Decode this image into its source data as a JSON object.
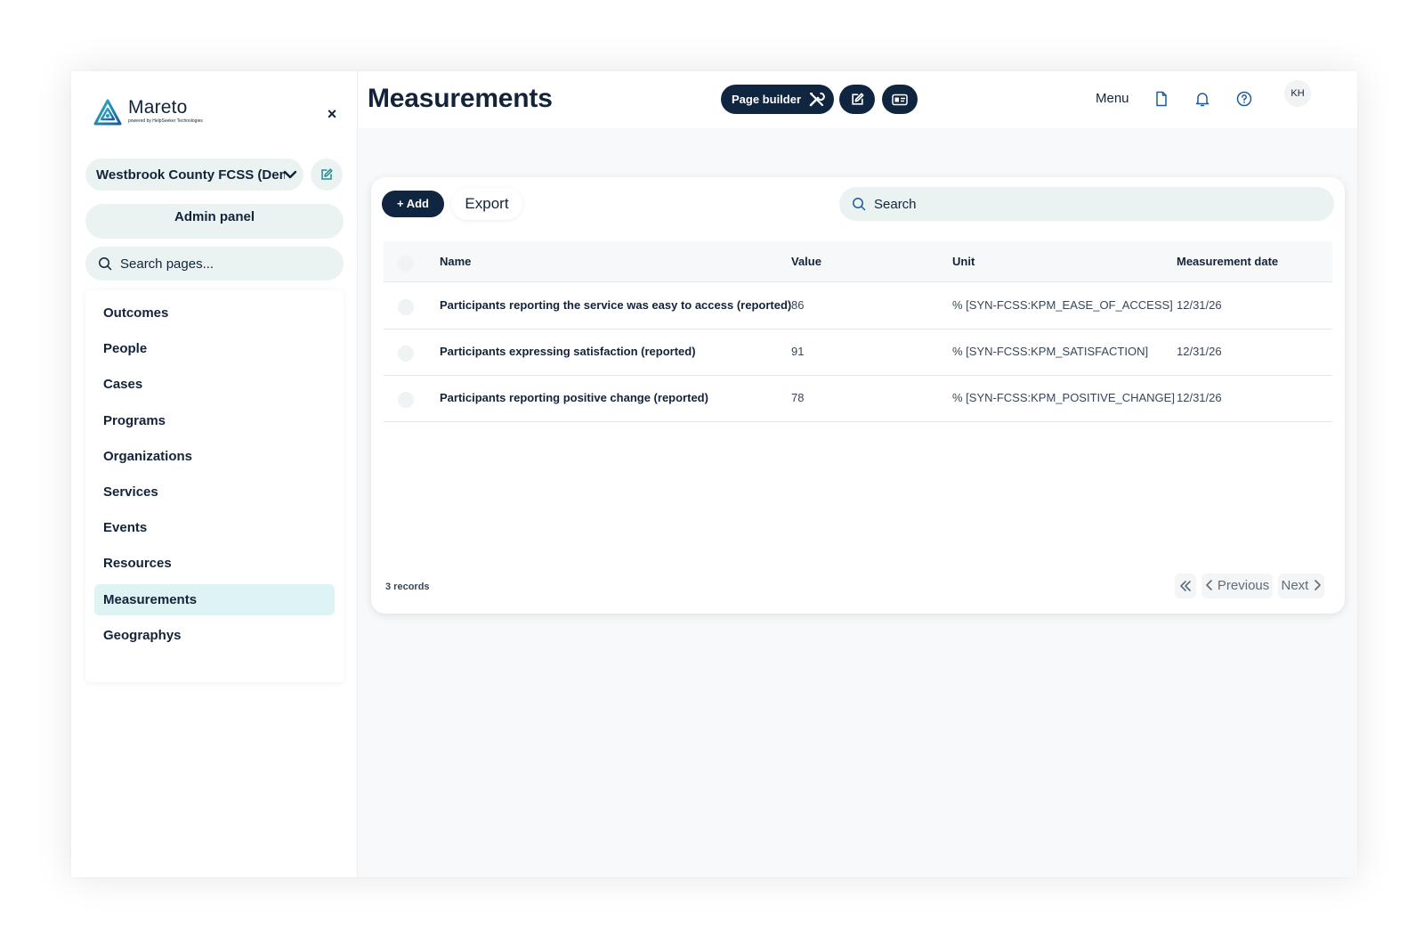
{
  "sidebar": {
    "brand_name": "Mareto",
    "brand_sub": "powered by HelpSeeker Technologies",
    "close_symbol": "×",
    "org_select_value": "Westbrook County FCSS (Demonstration)",
    "admin_label": "Admin panel",
    "search_placeholder": "Search pages...",
    "items": [
      {
        "label": "Outcomes"
      },
      {
        "label": "People"
      },
      {
        "label": "Cases"
      },
      {
        "label": "Programs"
      },
      {
        "label": "Organizations"
      },
      {
        "label": "Services"
      },
      {
        "label": "Events"
      },
      {
        "label": "Resources"
      },
      {
        "label": "Measurements",
        "active": true
      },
      {
        "label": "Geographys"
      }
    ]
  },
  "header": {
    "title": "Measurements",
    "page_builder_label": "Page builder",
    "menu_label": "Menu",
    "avatar_initials": "KH"
  },
  "toolbar": {
    "add_label": "+ Add",
    "export_label": "Export",
    "search_placeholder": "Search"
  },
  "table": {
    "columns": [
      "Name",
      "Value",
      "Unit",
      "Measurement date"
    ],
    "rows": [
      {
        "name": "Participants reporting the service was easy to access (reported)",
        "value": "86",
        "unit": "% [SYN-FCSS:KPM_EASE_OF_ACCESS]",
        "date": "12/31/26"
      },
      {
        "name": "Participants expressing satisfaction (reported)",
        "value": "91",
        "unit": "% [SYN-FCSS:KPM_SATISFACTION]",
        "date": "12/31/26"
      },
      {
        "name": "Participants reporting positive change (reported)",
        "value": "78",
        "unit": "% [SYN-FCSS:KPM_POSITIVE_CHANGE]",
        "date": "12/31/26"
      }
    ]
  },
  "footer": {
    "records_label": "3 records",
    "previous_label": "Previous",
    "next_label": "Next"
  },
  "colors": {
    "brand_dark": "#0f2540",
    "accent_teal": "#1d9bb0",
    "pill_bg": "#eaf3f2",
    "active_nav_bg": "#def3f4"
  }
}
